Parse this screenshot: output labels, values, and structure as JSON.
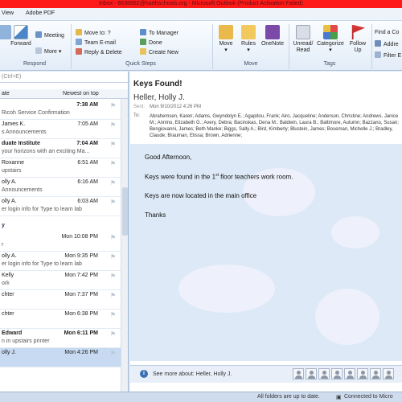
{
  "window": {
    "title": "Inbox - 6636882@harthschools.org - Microsoft Outlook (Product Activation Failed)"
  },
  "menu": {
    "tabs": [
      "View",
      "Adobe PDF"
    ]
  },
  "ribbon": {
    "respond": {
      "reply_all": "Reply All",
      "forward": "Forward",
      "meeting": "Meeting",
      "more": "More",
      "label": "Respond",
      "im": "Ricoh Service Confirmation"
    },
    "quick_steps": {
      "move_to": "Move to: ?",
      "team_email": "Team E-mail",
      "reply_delete": "Reply & Delete",
      "to_manager": "To Manager",
      "done": "Done",
      "create_new": "Create New",
      "label": "Quick Steps"
    },
    "move": {
      "move": "Move",
      "rules": "Rules",
      "onenote": "OneNote",
      "label": "Move"
    },
    "tags": {
      "unread_read": "Unread/ Read",
      "categorize": "Categorize",
      "follow_up": "Follow Up",
      "label": "Tags"
    },
    "find": {
      "find_contact": "Find a Co",
      "address_book": "Addre",
      "filter_email": "Filter E"
    }
  },
  "list": {
    "search_placeholder": "(Ctrl+E)",
    "col_from": "ate",
    "col_sort": "Newest on top",
    "groups": {
      "yesterday": "y"
    },
    "messages": [
      {
        "from": "",
        "time": "7:38 AM",
        "subject": "Ricoh Service Confirmation",
        "unread": true
      },
      {
        "from": "James K.",
        "time": "7:05 AM",
        "subject": "s Announcements",
        "unread": false
      },
      {
        "from": "duate Institute",
        "time": "7:04 AM",
        "subject": "your horizons with an exciting Ma...",
        "unread": true
      },
      {
        "from": "Roxanne",
        "time": "6:51 AM",
        "subject": "upstairs",
        "unread": false
      },
      {
        "from": "olly A.",
        "time": "6:16 AM",
        "subject": "Announcements",
        "unread": false
      },
      {
        "from": "olly A.",
        "time": "6:03 AM",
        "subject": "er login info for Type to learn lab",
        "unread": false
      },
      {
        "from": "",
        "time": "Mon 10:08 PM",
        "subject": "r",
        "unread": false
      },
      {
        "from": "olly A.",
        "time": "Mon 9:35 PM",
        "subject": "er login info for Type to learn lab",
        "unread": false
      },
      {
        "from": "Kelly",
        "time": "Mon 7:42 PM",
        "subject": "ork",
        "unread": false
      },
      {
        "from": "chter",
        "time": "Mon 7:37 PM",
        "subject": "",
        "unread": false
      },
      {
        "from": "chter",
        "time": "Mon 6:38 PM",
        "subject": "",
        "unread": false
      },
      {
        "from": "Edward",
        "time": "Mon 6:11 PM",
        "subject": "n in upstairs printer",
        "unread": true
      },
      {
        "from": "olly J.",
        "time": "Mon 4:26 PM",
        "subject": "",
        "unread": false,
        "selected": true
      }
    ]
  },
  "reading": {
    "subject": "Keys Found!",
    "sender": "Heller, Holly J.",
    "sent_label": "Sent:",
    "sent": "Mon 9/10/2012 4:26 PM",
    "to_label": "To:",
    "to": "Abrahemsen, Karen; Adams, Gwyndolyn E.; Agapitou, Frank; Airo, Jacqueline; Anderson, Christine; Andrews, Janice M.; Annino, Elizabeth G.; Avery, Debra; Bacinskas, Dena M.; Baldwin, Laura B.; Baltimore, Autumn; Bazzano, Susan; Bengiovanni, James; Beth Manke; Biggs, Sally A.; Bird, Kimberly; Blustein, James; Boseman, Michelle J.; Bradley, Claude; Brauman, Elissa; Brown, Adrienne;",
    "greeting": "Good Afternoon,",
    "line1_a": "Keys were found in the 1",
    "line1_sup": "st",
    "line1_b": " floor teachers work room.",
    "line2": "Keys are now located in the main office",
    "closing": "Thanks",
    "see_more": "See more about: Heller, Holly J."
  },
  "status": {
    "folders": "All folders are up to date.",
    "connected": "Connected to Micro"
  }
}
